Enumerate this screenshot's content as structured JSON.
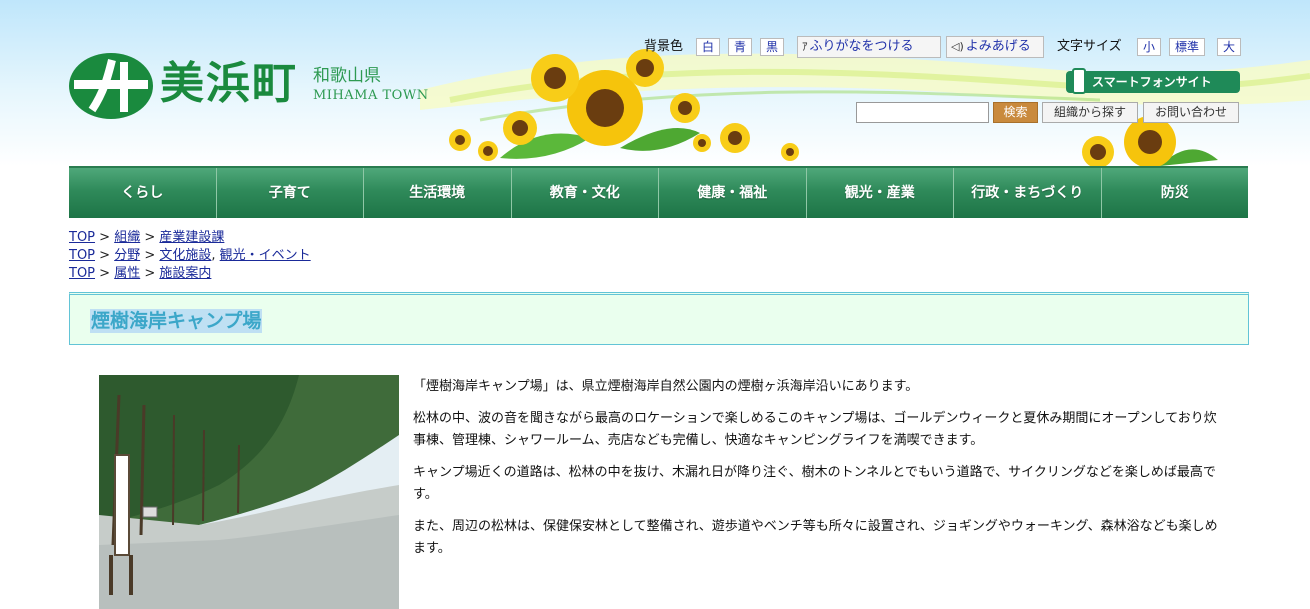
{
  "header": {
    "logo": {
      "name": "美浜町",
      "prefecture": "和歌山県",
      "roman": "MIHAMA TOWN"
    },
    "bg_color_label": "背景色",
    "bg_colors": [
      "白",
      "青",
      "黒"
    ],
    "furigana_button": "ふりがなをつける",
    "read_aloud_button": "よみあげる",
    "text_size_label": "文字サイズ",
    "text_sizes": [
      "小",
      "標準",
      "大"
    ],
    "smartphone_link": "スマートフォンサイト",
    "search_placeholder": "",
    "search_button": "検索",
    "org_search_button": "組織から探す",
    "contact_button": "お問い合わせ",
    "accent_color": "#1f8a58"
  },
  "nav": {
    "items": [
      "くらし",
      "子育て",
      "生活環境",
      "教育・文化",
      "健康・福祉",
      "観光・産業",
      "行政・まちづくり",
      "防災"
    ]
  },
  "breadcrumbs": {
    "row1": {
      "top": "TOP",
      "a": "組織",
      "b": "産業建設課"
    },
    "row2": {
      "top": "TOP",
      "a": "分野",
      "b": "文化施設",
      "c": "観光・イベント"
    },
    "row3": {
      "top": "TOP",
      "a": "属性",
      "b": "施設案内"
    }
  },
  "page": {
    "title": "煙樹海岸キャンプ場",
    "paragraphs": [
      "「煙樹海岸キャンプ場」は、県立煙樹海岸自然公園内の煙樹ヶ浜海岸沿いにあります。",
      "松林の中、波の音を聞きながら最高のロケーションで楽しめるこのキャンプ場は、ゴールデンウィークと夏休み期間にオープンしており炊事棟、管理棟、シャワールーム、売店なども完備し、快適なキャンピングライフを満喫できます。",
      "キャンプ場近くの道路は、松林の中を抜け、木漏れ日が降り注ぐ、樹木のトンネルとでもいう道路で、サイクリングなどを楽しめば最高です。",
      "また、周辺の松林は、保健保安林として整備され、遊歩道やベンチ等も所々に設置され、ジョギングやウォーキング、森林浴なども楽しめます。"
    ]
  }
}
